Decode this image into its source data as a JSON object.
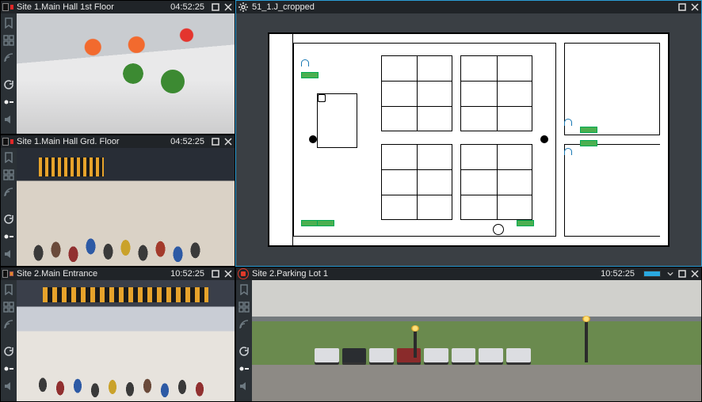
{
  "tiles": {
    "hall1": {
      "title": "Site 1.Main Hall 1st Floor",
      "time": "04:52:25",
      "rec_color": "red"
    },
    "hall2": {
      "title": "Site 1.Main Hall Grd. Floor",
      "time": "04:52:25",
      "rec_color": "red"
    },
    "entrance": {
      "title": "Site 2.Main Entrance",
      "time": "10:52:25",
      "rec_color": "orange"
    },
    "map": {
      "title": "51_1.J_cropped"
    },
    "parking": {
      "title": "Site 2.Parking Lot 1",
      "time": "10:52:25",
      "status": "live"
    }
  },
  "icons": {
    "camera": "camera-icon",
    "gear": "gear-icon",
    "alarm": "alarm-icon",
    "maximize": "maximize-icon",
    "close": "close-icon",
    "dropdown": "chevron-down-icon"
  },
  "colors": {
    "accent": "#2a9dd6",
    "panel": "#2b3136",
    "rec_red": "#e02828",
    "rec_orange": "#e08a28",
    "live_blue": "#2aa8e0"
  }
}
